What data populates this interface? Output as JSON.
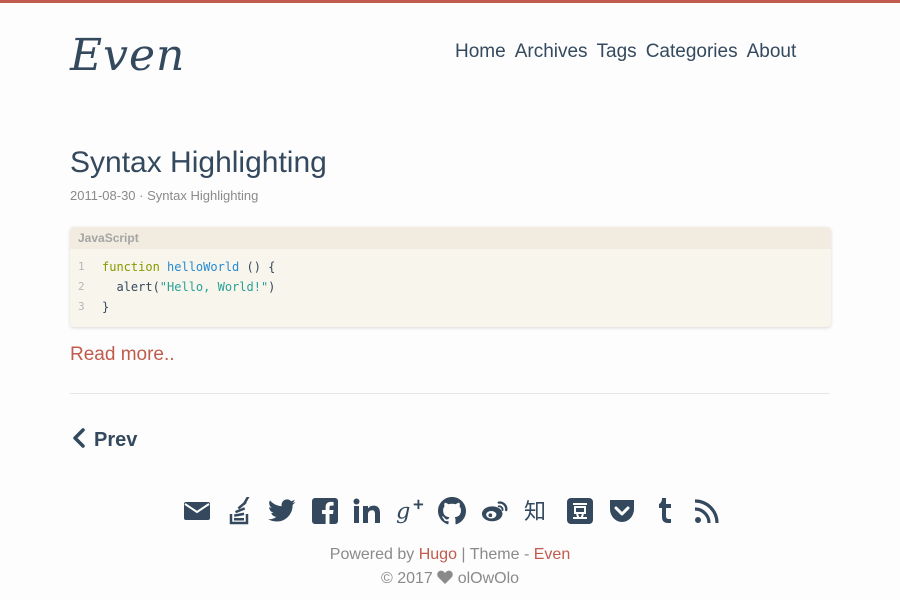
{
  "site": {
    "logo": "Even",
    "accent_color": "#c05b4d",
    "text_color": "#34495e"
  },
  "nav": {
    "items": [
      {
        "label": "Home"
      },
      {
        "label": "Archives"
      },
      {
        "label": "Tags"
      },
      {
        "label": "Categories"
      },
      {
        "label": "About"
      }
    ]
  },
  "post": {
    "title": "Syntax Highlighting",
    "date": "2011-08-30",
    "separator": " · ",
    "category": "Syntax Highlighting",
    "code": {
      "language": "JavaScript",
      "lines": [
        {
          "num": "1",
          "keyword": "function",
          "fn_name": "helloWorld",
          "rest": " () {"
        },
        {
          "num": "2",
          "indent": "  alert(",
          "string": "\"Hello, World!\"",
          "rest": ")"
        },
        {
          "num": "3",
          "text": "}"
        }
      ]
    },
    "read_more": "Read more.."
  },
  "pagination": {
    "prev_label": "Prev"
  },
  "social_icons": [
    "email-icon",
    "stack-overflow-icon",
    "twitter-icon",
    "facebook-icon",
    "linkedin-icon",
    "google-plus-icon",
    "github-icon",
    "weibo-icon",
    "zhihu-icon",
    "douban-icon",
    "pocket-icon",
    "tumblr-icon",
    "rss-icon"
  ],
  "footer": {
    "powered_prefix": "Powered by ",
    "hugo": "Hugo",
    "theme_sep": " | Theme - ",
    "theme": "Even",
    "copyright_prefix": "© 2017 ",
    "author": "olOwOlo"
  }
}
